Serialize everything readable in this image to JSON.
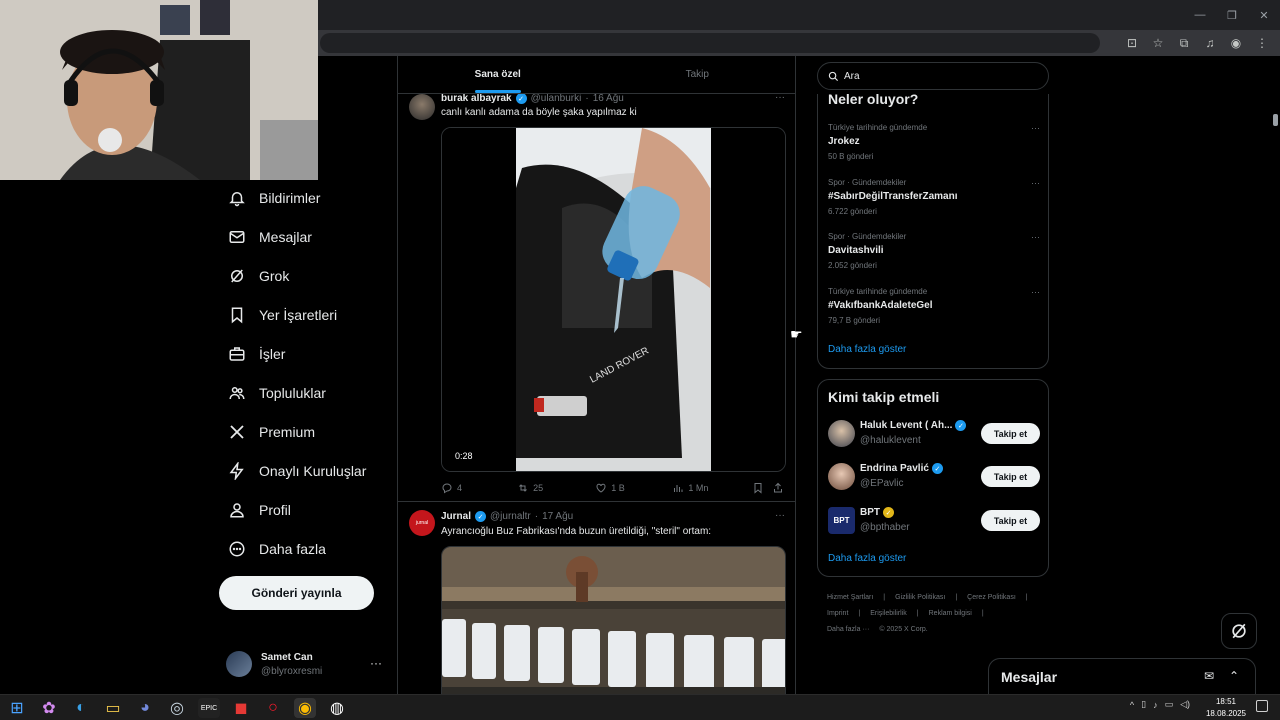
{
  "nav": {
    "items": [
      {
        "label": "Bildirimler",
        "icon": "bell-icon"
      },
      {
        "label": "Mesajlar",
        "icon": "envelope-icon"
      },
      {
        "label": "Grok",
        "icon": "grok-icon"
      },
      {
        "label": "Yer İşaretleri",
        "icon": "bookmark-icon"
      },
      {
        "label": "İşler",
        "icon": "briefcase-icon"
      },
      {
        "label": "Topluluklar",
        "icon": "people-icon"
      },
      {
        "label": "Premium",
        "icon": "x-logo-icon"
      },
      {
        "label": "Onaylı Kuruluşlar",
        "icon": "lightning-icon"
      },
      {
        "label": "Profil",
        "icon": "person-icon"
      },
      {
        "label": "Daha fazla",
        "icon": "more-circle-icon"
      }
    ],
    "post_button": "Gönderi yayınla",
    "account": {
      "name": "Samet Can",
      "handle": "@blyroxresmi",
      "more": "···"
    }
  },
  "feed": {
    "tabs": [
      {
        "label": "Sana özel",
        "active": true
      },
      {
        "label": "Takip",
        "active": false
      }
    ],
    "tweets": [
      {
        "name": "burak albayrak",
        "handle": "@ulanburki",
        "date": "16 Ağu",
        "dot": "·",
        "text": "canlı kanlı adama da böyle şaka yapılmaz ki",
        "duration": "0:28",
        "replies": "4",
        "retweets": "25",
        "likes": "1 B",
        "views": "1 Mn"
      },
      {
        "name": "Jurnal",
        "handle": "@jurnaltr",
        "date": "17 Ağu",
        "dot": "·",
        "text": "Ayrancıoğlu Buz Fabrikası'nda buzun üretildiği, \"steril\" ortam:"
      }
    ]
  },
  "right": {
    "search_placeholder": "Ara",
    "trends_title": "Neler oluyor?",
    "trends": [
      {
        "meta": "Türkiye tarihinde gündemde",
        "title": "Jrokez",
        "count": "50 B gönderi"
      },
      {
        "meta": "Spor · Gündemdekiler",
        "title": "#SabırDeğilTransferZamanı",
        "count": "6.722 gönderi"
      },
      {
        "meta": "Spor · Gündemdekiler",
        "title": "Davitashvili",
        "count": "2.052 gönderi"
      },
      {
        "meta": "Türkiye tarihinde gündemde",
        "title": "#VakıfbankAdaleteGel",
        "count": "79,7 B gönderi"
      }
    ],
    "trends_more": "Daha fazla göster",
    "follow_title": "Kimi takip etmeli",
    "follow": [
      {
        "name": "Haluk Levent ( Ah...",
        "handle": "@haluklevent",
        "badge": "blue",
        "button": "Takip et"
      },
      {
        "name": "Endrina Pavlić",
        "handle": "@EPavlic",
        "badge": "blue",
        "button": "Takip et"
      },
      {
        "name": "BPT",
        "handle": "@bpthaber",
        "badge": "gold",
        "button": "Takip et"
      }
    ],
    "follow_more": "Daha fazla göster",
    "footer": [
      "Hizmet Şartları",
      "|",
      "Gizlilik Politikası",
      "|",
      "Çerez Politikası",
      "|",
      "Imprint",
      "|",
      "Erişilebilirlik",
      "|",
      "Reklam bilgisi",
      "|",
      "Daha fazla ···",
      "© 2025 X Corp."
    ]
  },
  "messages_drawer": {
    "title": "Mesajlar"
  },
  "taskbar": {
    "time": "18:51",
    "date": "18.08.2025"
  },
  "colors": {
    "accent": "#1d9bf0",
    "background": "#000000",
    "border": "#2f3336",
    "muted": "#71767b"
  }
}
